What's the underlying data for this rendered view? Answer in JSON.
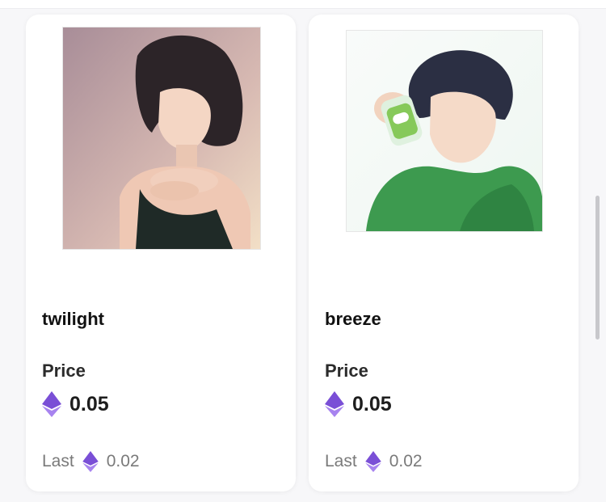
{
  "cards": [
    {
      "name": "twilight",
      "price_label": "Price",
      "price": "0.05",
      "last_label": "Last",
      "last_price": "0.02",
      "currency_icon": "ethereum-icon"
    },
    {
      "name": "breeze",
      "price_label": "Price",
      "price": "0.05",
      "last_label": "Last",
      "last_price": "0.02",
      "currency_icon": "ethereum-icon"
    }
  ],
  "colors": {
    "eth_primary": "#7a4fd6",
    "eth_secondary": "#a783ef",
    "card_bg": "#ffffff",
    "page_bg": "#f7f7f9"
  }
}
